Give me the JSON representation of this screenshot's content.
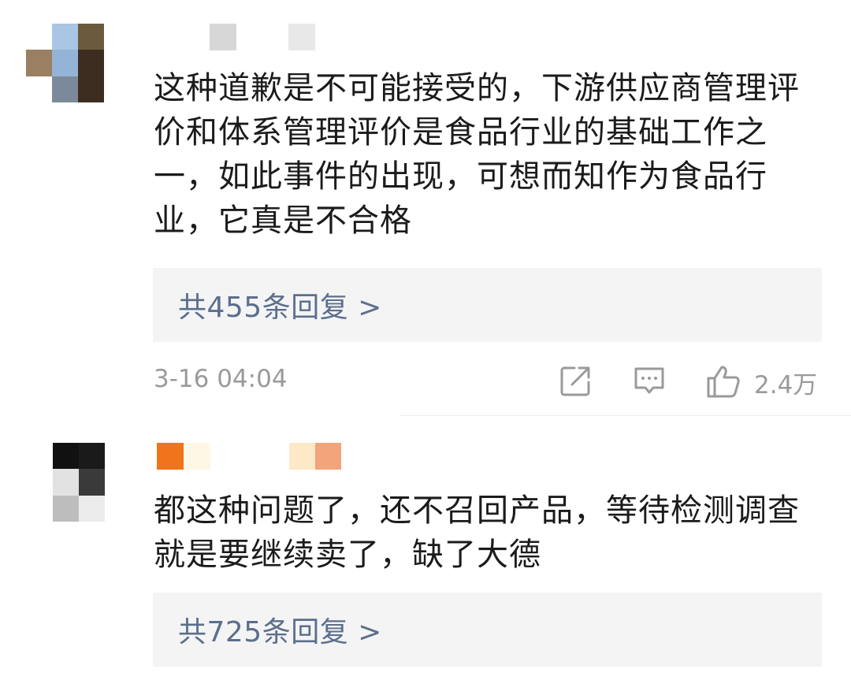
{
  "comments": [
    {
      "text": "这种道歉是不可能接受的，下游供应商管理评价和体系管理评价是食品行业的基础工作之一，如此事件的出现，可想而知作为食品行业，它真是不合格",
      "replies_label": "共455条回复 >",
      "timestamp": "3-16 04:04",
      "likes": "2.4万",
      "avatar_colors": [
        "#ffffff",
        "#a9c6e4",
        "#6b5a3e",
        "#ffffff",
        "#9a7f63",
        "#93b4d7",
        "#3d2d20",
        "#ffffff",
        "#ffffff",
        "#7b8a9a",
        "#3d2d20",
        "#ffffff"
      ],
      "username_colors": [
        "#d7d7d7",
        "#ffffff",
        "#e8e8e8"
      ]
    },
    {
      "text": "都这种问题了，还不召回产品，等待检测调查就是要继续卖了，缺了大德",
      "replies_label": "共725条回复 >",
      "avatar_colors": [
        "#111111",
        "#1a1a1a",
        "#e2e2e2",
        "#3a3a3a",
        "#bdbdbd",
        "#ececec"
      ],
      "username_colors": [
        "#f0741c",
        "#fff7e6",
        "#ffffff",
        "#fde9c8",
        "#f3a47a"
      ]
    }
  ],
  "icons": {
    "share": "share-icon",
    "comment": "comment-icon",
    "like": "thumbs-up-icon"
  }
}
